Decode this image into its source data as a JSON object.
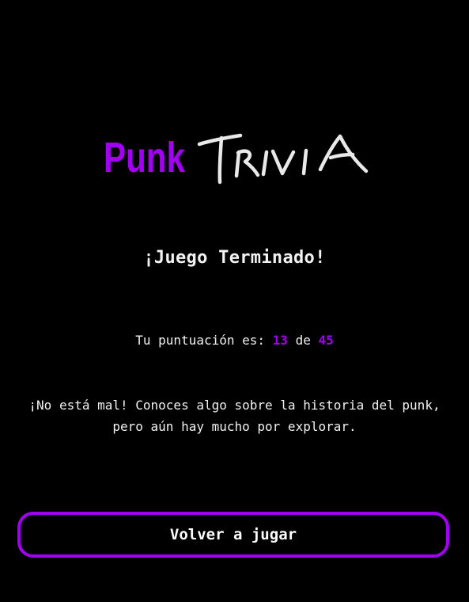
{
  "logo": {
    "word1": "Punk",
    "word2": "TRIVIA",
    "accent": "#a100f2"
  },
  "result": {
    "headline": "¡Juego Terminado!",
    "score_prefix": "Tu puntuación es:",
    "score": "13",
    "score_joiner": "de",
    "total": "45"
  },
  "message": "¡No está mal! Conoces algo sobre la historia del punk, pero aún hay mucho por explorar.",
  "button": {
    "label": "Volver a jugar"
  },
  "colors": {
    "background": "#000000",
    "accent": "#a100f2",
    "text": "#f2f2f2"
  }
}
